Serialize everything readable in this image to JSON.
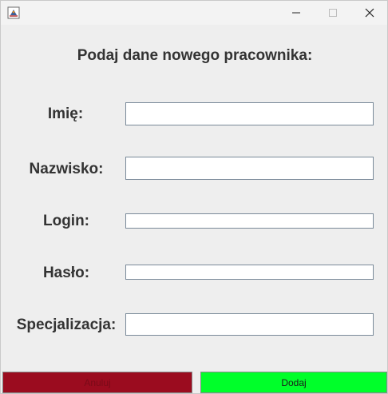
{
  "window": {
    "icons": {
      "app": "java-app-icon",
      "minimize": "minimize-icon",
      "maximize": "maximize-icon",
      "close": "close-icon"
    }
  },
  "form": {
    "heading": "Podaj dane nowego pracownika:",
    "fields": [
      {
        "label": "Imię:",
        "value": ""
      },
      {
        "label": "Nazwisko:",
        "value": ""
      },
      {
        "label": "Login:",
        "value": ""
      },
      {
        "label": "Hasło:",
        "value": ""
      },
      {
        "label": "Specjalizacja:",
        "value": ""
      }
    ]
  },
  "buttons": {
    "cancel": "Anuluj",
    "add": "Dodaj"
  },
  "colors": {
    "cancel_bg": "#9b0c1f",
    "add_bg": "#00ff2a",
    "window_bg": "#eeeeee"
  }
}
